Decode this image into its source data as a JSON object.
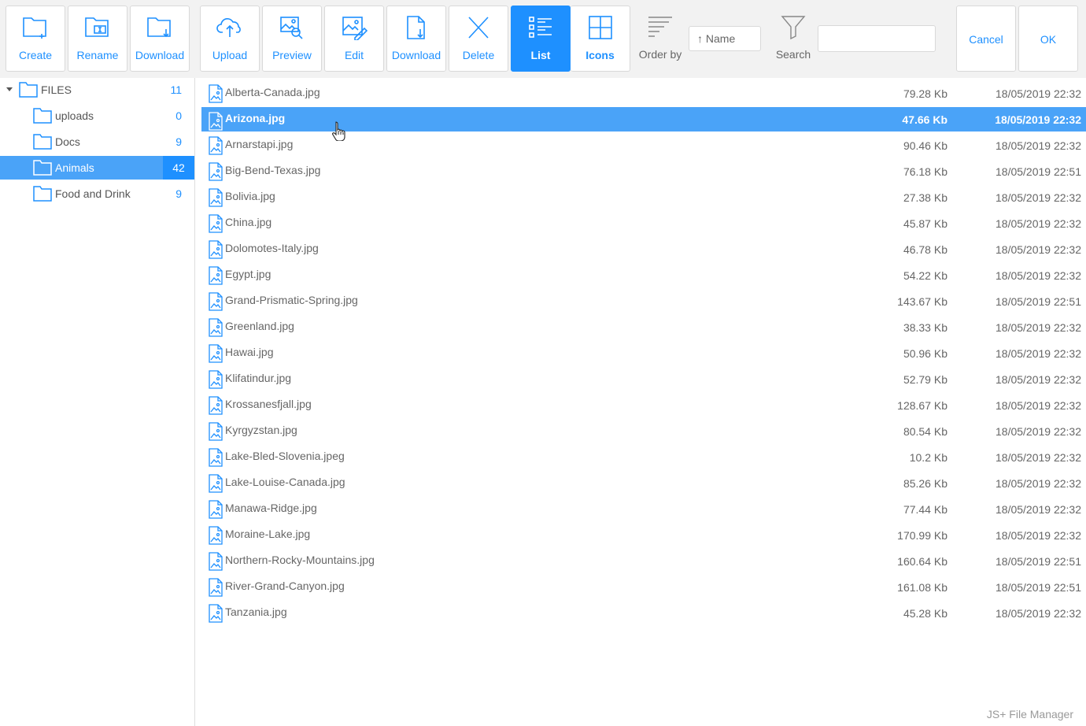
{
  "toolbar": {
    "buttons": [
      {
        "label": "Create",
        "icon": "folder-plus-icon"
      },
      {
        "label": "Rename",
        "icon": "folder-rename-icon"
      },
      {
        "label": "Download",
        "icon": "folder-download-icon"
      },
      {
        "label": "Upload",
        "icon": "cloud-upload-icon"
      },
      {
        "label": "Preview",
        "icon": "image-search-icon"
      },
      {
        "label": "Edit",
        "icon": "image-edit-icon"
      },
      {
        "label": "Download",
        "icon": "file-download-icon"
      },
      {
        "label": "Delete",
        "icon": "close-icon"
      },
      {
        "label": "List",
        "icon": "list-view-icon"
      },
      {
        "label": "Icons",
        "icon": "grid-view-icon"
      }
    ],
    "order_label": "Order by",
    "order_value": "↑ Name",
    "search_label": "Search",
    "search_value": "",
    "cancel_label": "Cancel",
    "ok_label": "OK",
    "accent_color": "#1e90ff"
  },
  "tree": {
    "root": {
      "label": "FILES",
      "count": "11"
    },
    "items": [
      {
        "label": "uploads",
        "count": "0"
      },
      {
        "label": "Docs",
        "count": "9"
      },
      {
        "label": "Animals",
        "count": "42",
        "selected": true
      },
      {
        "label": "Food and Drink",
        "count": "9"
      }
    ]
  },
  "files": [
    {
      "name": "Alberta-Canada.jpg",
      "size": "79.28 Kb",
      "date": "18/05/2019 22:32"
    },
    {
      "name": "Arizona.jpg",
      "size": "47.66 Kb",
      "date": "18/05/2019 22:32",
      "selected": true
    },
    {
      "name": "Arnarstapi.jpg",
      "size": "90.46 Kb",
      "date": "18/05/2019 22:32"
    },
    {
      "name": "Big-Bend-Texas.jpg",
      "size": "76.18 Kb",
      "date": "18/05/2019 22:51"
    },
    {
      "name": "Bolivia.jpg",
      "size": "27.38 Kb",
      "date": "18/05/2019 22:32"
    },
    {
      "name": "China.jpg",
      "size": "45.87 Kb",
      "date": "18/05/2019 22:32"
    },
    {
      "name": "Dolomotes-Italy.jpg",
      "size": "46.78 Kb",
      "date": "18/05/2019 22:32"
    },
    {
      "name": "Egypt.jpg",
      "size": "54.22 Kb",
      "date": "18/05/2019 22:32"
    },
    {
      "name": "Grand-Prismatic-Spring.jpg",
      "size": "143.67 Kb",
      "date": "18/05/2019 22:51"
    },
    {
      "name": "Greenland.jpg",
      "size": "38.33 Kb",
      "date": "18/05/2019 22:32"
    },
    {
      "name": "Hawai.jpg",
      "size": "50.96 Kb",
      "date": "18/05/2019 22:32"
    },
    {
      "name": "Klifatindur.jpg",
      "size": "52.79 Kb",
      "date": "18/05/2019 22:32"
    },
    {
      "name": "Krossanesfjall.jpg",
      "size": "128.67 Kb",
      "date": "18/05/2019 22:32"
    },
    {
      "name": "Kyrgyzstan.jpg",
      "size": "80.54 Kb",
      "date": "18/05/2019 22:32"
    },
    {
      "name": "Lake-Bled-Slovenia.jpeg",
      "size": "10.2 Kb",
      "date": "18/05/2019 22:32"
    },
    {
      "name": "Lake-Louise-Canada.jpg",
      "size": "85.26 Kb",
      "date": "18/05/2019 22:32"
    },
    {
      "name": "Manawa-Ridge.jpg",
      "size": "77.44 Kb",
      "date": "18/05/2019 22:32"
    },
    {
      "name": "Moraine-Lake.jpg",
      "size": "170.99 Kb",
      "date": "18/05/2019 22:32"
    },
    {
      "name": "Northern-Rocky-Mountains.jpg",
      "size": "160.64 Kb",
      "date": "18/05/2019 22:51"
    },
    {
      "name": "River-Grand-Canyon.jpg",
      "size": "161.08 Kb",
      "date": "18/05/2019 22:51"
    },
    {
      "name": "Tanzania.jpg",
      "size": "45.28 Kb",
      "date": "18/05/2019 22:32"
    }
  ],
  "brand": "JS+ File Manager"
}
